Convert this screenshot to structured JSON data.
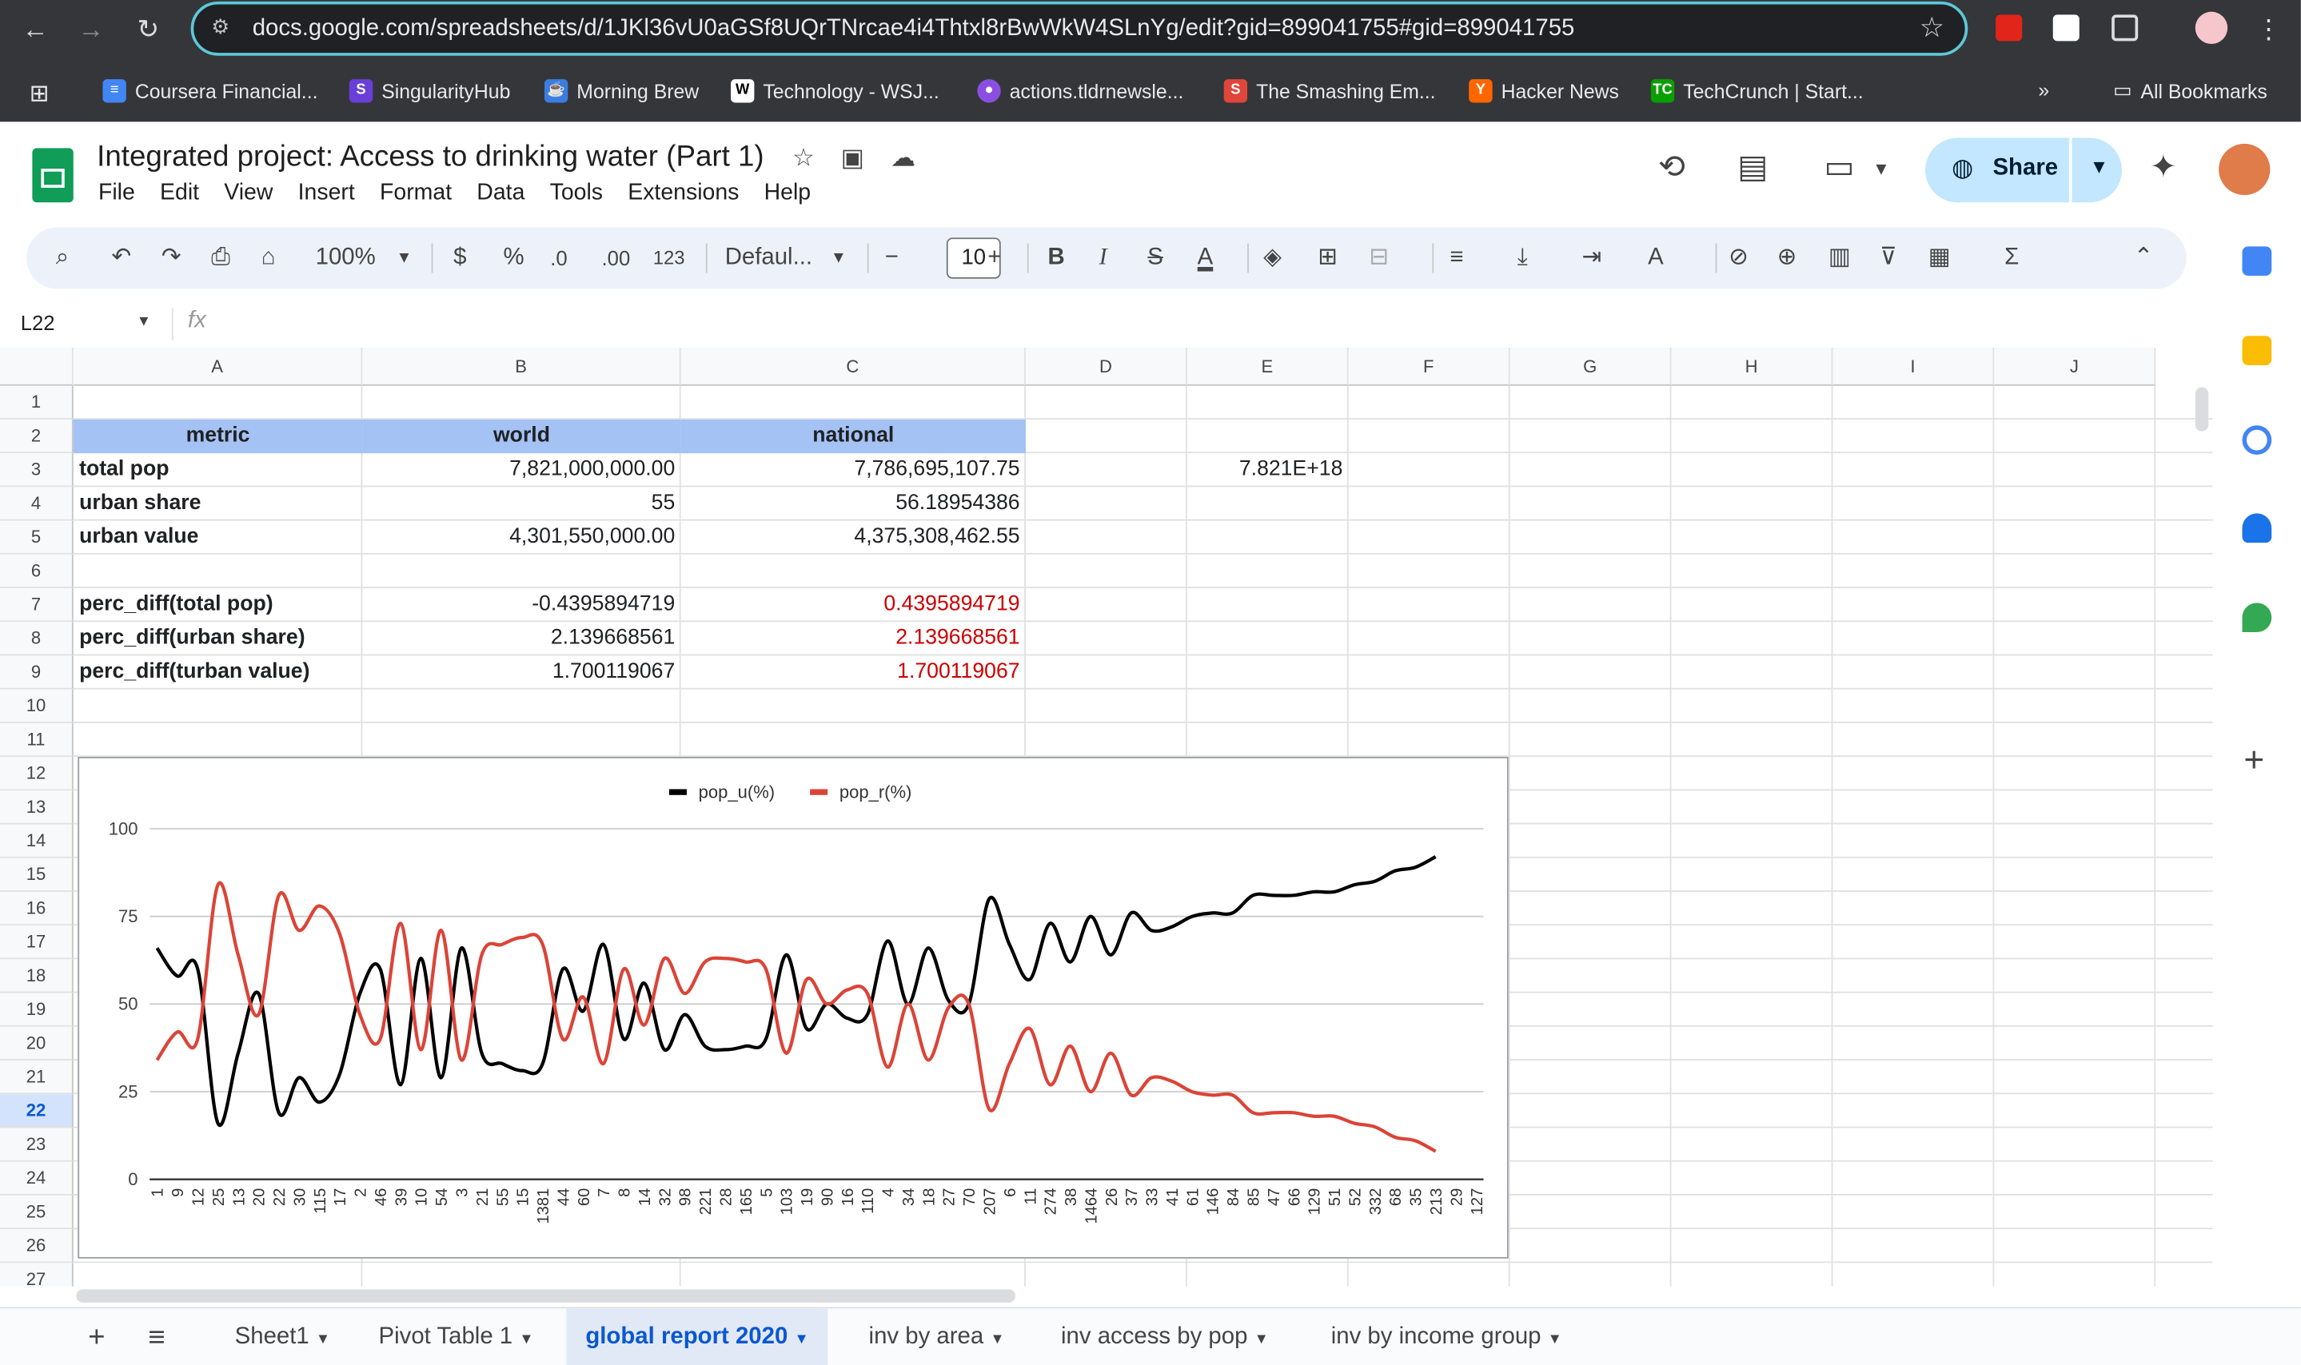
{
  "browser": {
    "url": "docs.google.com/spreadsheets/d/1JKl36vU0aGSf8UQrTNrcae4i4Thtxl8rBwWkW4SLnYg/edit?gid=899041755#gid=899041755",
    "bookmarks": [
      {
        "label": "Coursera Financial..."
      },
      {
        "label": "SingularityHub"
      },
      {
        "label": "Morning Brew"
      },
      {
        "label": "Technology - WSJ..."
      },
      {
        "label": "actions.tldrnewsle..."
      },
      {
        "label": "The Smashing Em..."
      },
      {
        "label": "Hacker News"
      },
      {
        "label": "TechCrunch | Start..."
      }
    ],
    "bookmarks_overflow": "»",
    "all_bookmarks": "All Bookmarks"
  },
  "doc": {
    "title": "Integrated project: Access to drinking water (Part 1)",
    "menu": [
      "File",
      "Edit",
      "View",
      "Insert",
      "Format",
      "Data",
      "Tools",
      "Extensions",
      "Help"
    ],
    "share_label": "Share"
  },
  "toolbar": {
    "zoom": "100%",
    "currency": "$",
    "percent": "%",
    "dec_decrease": ".0",
    "dec_increase": ".00",
    "number_format": "123",
    "font": "Defaul...",
    "font_size": "10",
    "bold": "B",
    "italic": "I",
    "text_color": "A"
  },
  "formula_bar": {
    "name_box": "L22",
    "fx": "fx",
    "formula": ""
  },
  "grid": {
    "columns": [
      "A",
      "B",
      "C",
      "D",
      "E",
      "F",
      "G",
      "H",
      "I",
      "J"
    ],
    "rows": [
      "1",
      "2",
      "3",
      "4",
      "5",
      "6",
      "7",
      "8",
      "9",
      "10",
      "11",
      "12",
      "13",
      "14",
      "15",
      "16",
      "17",
      "18",
      "19",
      "20",
      "21",
      "22",
      "23",
      "24",
      "25",
      "26",
      "27"
    ],
    "selected_row": "22",
    "header": {
      "a": "metric",
      "b": "world",
      "c": "national"
    },
    "data_rows": [
      {
        "a": "total pop",
        "b": "7,821,000,000.00",
        "c": "7,786,695,107.75",
        "e": "7.821E+18"
      },
      {
        "a": "urban share",
        "b": "55",
        "c": "56.18954386"
      },
      {
        "a": "urban value",
        "b": "4,301,550,000.00",
        "c": "4,375,308,462.55"
      }
    ],
    "diff_rows": [
      {
        "a": "perc_diff(total pop)",
        "b": "-0.4395894719",
        "c": "0.4395894719"
      },
      {
        "a": "perc_diff(urban share)",
        "b": "2.139668561",
        "c": "2.139668561"
      },
      {
        "a": "perc_diff(turban value)",
        "b": "1.700119067",
        "c": "1.700119067"
      }
    ]
  },
  "chart_data": {
    "type": "line",
    "title": "",
    "xlabel": "",
    "ylabel": "",
    "ylim": [
      0,
      100
    ],
    "yticks": [
      0,
      25,
      50,
      75,
      100
    ],
    "grid": true,
    "legend_position": "top",
    "colors": {
      "pop_u(%)": "#000000",
      "pop_r(%)": "#db4437"
    },
    "categories": [
      "1",
      "9",
      "12",
      "25",
      "13",
      "20",
      "22",
      "30",
      "115",
      "17",
      "2",
      "46",
      "39",
      "10",
      "54",
      "3",
      "21",
      "55",
      "15",
      "1381",
      "44",
      "60",
      "7",
      "8",
      "14",
      "32",
      "98",
      "221",
      "28",
      "165",
      "5",
      "103",
      "19",
      "90",
      "16",
      "110",
      "4",
      "34",
      "18",
      "27",
      "70",
      "207",
      "6",
      "11",
      "274",
      "38",
      "1464",
      "26",
      "37",
      "33",
      "41",
      "61",
      "146",
      "84",
      "85",
      "47",
      "66",
      "129",
      "51",
      "52",
      "332",
      "68",
      "35",
      "213",
      "29",
      "127"
    ],
    "series": [
      {
        "name": "pop_u(%)",
        "values": [
          66,
          58,
          60,
          16,
          36,
          53,
          19,
          29,
          22,
          30,
          53,
          60,
          27,
          63,
          29,
          66,
          36,
          33,
          31,
          33,
          60,
          48,
          67,
          40,
          56,
          37,
          47,
          38,
          37,
          38,
          40,
          64,
          43,
          50,
          46,
          47,
          68,
          50,
          66,
          51,
          50,
          80,
          67,
          57,
          73,
          62,
          75,
          64,
          76,
          71,
          72,
          75,
          76,
          76,
          81,
          81,
          81,
          82,
          82,
          84,
          85,
          88,
          89,
          92
        ]
      },
      {
        "name": "pop_r(%)",
        "values": [
          34,
          42,
          40,
          84,
          64,
          47,
          81,
          71,
          78,
          70,
          47,
          40,
          73,
          37,
          71,
          34,
          64,
          67,
          69,
          67,
          40,
          52,
          33,
          60,
          44,
          63,
          53,
          62,
          63,
          62,
          60,
          36,
          57,
          50,
          54,
          53,
          32,
          50,
          34,
          49,
          50,
          20,
          33,
          43,
          27,
          38,
          25,
          36,
          24,
          29,
          28,
          25,
          24,
          24,
          19,
          19,
          19,
          18,
          18,
          16,
          15,
          12,
          11,
          8
        ]
      }
    ]
  },
  "sheet_tabs": [
    "Sheet1",
    "Pivot Table 1",
    "global report 2020",
    "inv by area",
    "inv access by pop",
    "inv by income group"
  ],
  "active_tab": "global report 2020"
}
